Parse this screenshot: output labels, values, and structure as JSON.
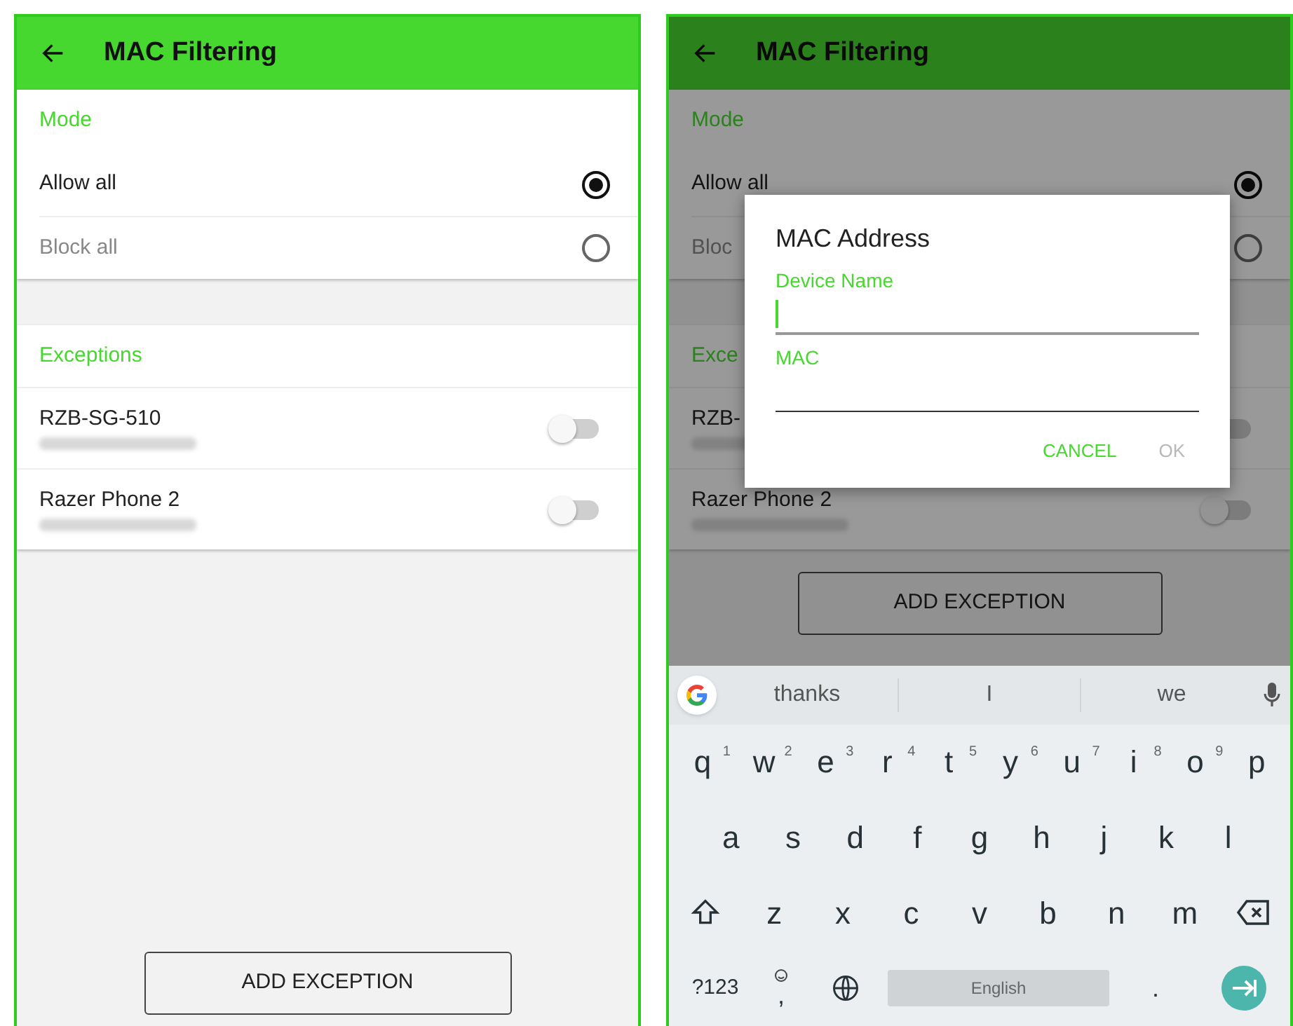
{
  "screens": [
    {
      "dimmed": false,
      "app_bar": {
        "title": "MAC Filtering"
      },
      "mode": {
        "header": "Mode",
        "options": [
          {
            "label": "Allow all",
            "selected": true
          },
          {
            "label": "Block all",
            "selected": false
          }
        ]
      },
      "exceptions": {
        "header": "Exceptions",
        "devices": [
          {
            "name": "RZB-SG-510",
            "on": false
          },
          {
            "name": "Razer Phone 2",
            "on": false
          }
        ]
      },
      "add_button": "ADD EXCEPTION"
    },
    {
      "dimmed": true,
      "app_bar": {
        "title": "MAC Filtering"
      },
      "mode": {
        "header": "Mode",
        "options": [
          {
            "label": "Allow all",
            "selected": true
          },
          {
            "label": "Bloc",
            "selected": false
          }
        ]
      },
      "exceptions": {
        "header": "Exce",
        "devices": [
          {
            "name": "RZB-",
            "on": false
          },
          {
            "name": "Razer Phone 2",
            "on": false
          }
        ]
      },
      "add_button": "ADD EXCEPTION",
      "dialog": {
        "title": "MAC Address",
        "fields": [
          {
            "label": "Device Name",
            "focused": true
          },
          {
            "label": "MAC",
            "focused": false
          }
        ],
        "buttons": [
          {
            "label": "CANCEL",
            "disabled": false
          },
          {
            "label": "OK",
            "disabled": true
          }
        ]
      },
      "keyboard": {
        "suggestions": [
          "thanks",
          "I",
          "we"
        ],
        "rows": [
          [
            {
              "label": "q",
              "hint": "1"
            },
            {
              "label": "w",
              "hint": "2"
            },
            {
              "label": "e",
              "hint": "3"
            },
            {
              "label": "r",
              "hint": "4"
            },
            {
              "label": "t",
              "hint": "5"
            },
            {
              "label": "y",
              "hint": "6"
            },
            {
              "label": "u",
              "hint": "7"
            },
            {
              "label": "i",
              "hint": "8"
            },
            {
              "label": "o",
              "hint": "9"
            },
            {
              "label": "p"
            }
          ],
          [
            {
              "label": "a"
            },
            {
              "label": "s"
            },
            {
              "label": "d"
            },
            {
              "label": "f"
            },
            {
              "label": "g"
            },
            {
              "label": "h"
            },
            {
              "label": "j"
            },
            {
              "label": "k"
            },
            {
              "label": "l"
            }
          ],
          [
            {
              "label": "z"
            },
            {
              "label": "x"
            },
            {
              "label": "c"
            },
            {
              "label": "v"
            },
            {
              "label": "b"
            },
            {
              "label": "n"
            },
            {
              "label": "m"
            }
          ]
        ],
        "symbols_key": "?123",
        "comma_key": ",",
        "space_key": "English",
        "period_key": "."
      }
    }
  ]
}
